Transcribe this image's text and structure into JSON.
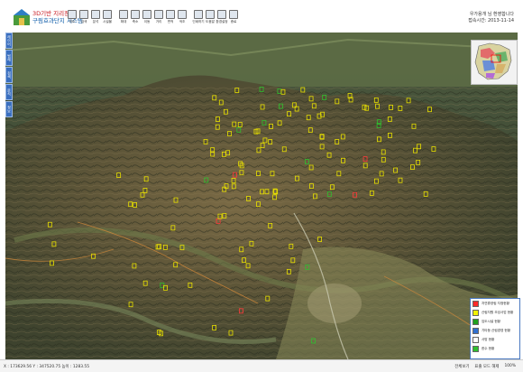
{
  "header": {
    "logo_line1": "3D기반 지리정보",
    "logo_line2": "구림효과단지 시스템",
    "user_line1": "우가용개 님 환영합니다",
    "user_line2": "접속시간: 2013-11-14"
  },
  "toolbar": [
    {
      "label": "지도",
      "icon": "map-icon"
    },
    {
      "label": "검색",
      "icon": "search-icon"
    },
    {
      "label": "분석",
      "icon": "chart-icon"
    },
    {
      "label": "시설물",
      "icon": "building-icon"
    },
    {
      "label": "확대",
      "icon": "zoom-in-icon"
    },
    {
      "label": "축소",
      "icon": "zoom-out-icon"
    },
    {
      "label": "이동",
      "icon": "pan-icon"
    },
    {
      "label": "거리",
      "icon": "ruler-icon"
    },
    {
      "label": "면적",
      "icon": "area-icon"
    },
    {
      "label": "색조",
      "icon": "color-icon"
    },
    {
      "label": "인쇄하기",
      "icon": "print-icon"
    },
    {
      "label": "도움말",
      "icon": "help-icon"
    },
    {
      "label": "환경설정",
      "icon": "gear-icon"
    },
    {
      "label": "종료",
      "icon": "exit-icon"
    }
  ],
  "left_tabs": [
    "레이어",
    "범례",
    "검색",
    "분석",
    "정보"
  ],
  "legend": [
    {
      "label": "자연휴양림 지정현황",
      "color": "#ff2a2a"
    },
    {
      "label": "산림자원 조성사업 현황",
      "color": "#f2f200"
    },
    {
      "label": "임도시설 현황",
      "color": "#20a020"
    },
    {
      "label": "기타등 산림경영 현황",
      "color": "#3070d0"
    },
    {
      "label": "사방 현황",
      "color": "#ffffff"
    },
    {
      "label": "한수 현황",
      "color": "#2fbf2f"
    }
  ],
  "status": {
    "coords": "X : 173629.56  Y : 347520.75  높이 : 1283.55",
    "tool1": "전체보기",
    "tool2": "표출 모드 해제",
    "zoom": "100%"
  }
}
